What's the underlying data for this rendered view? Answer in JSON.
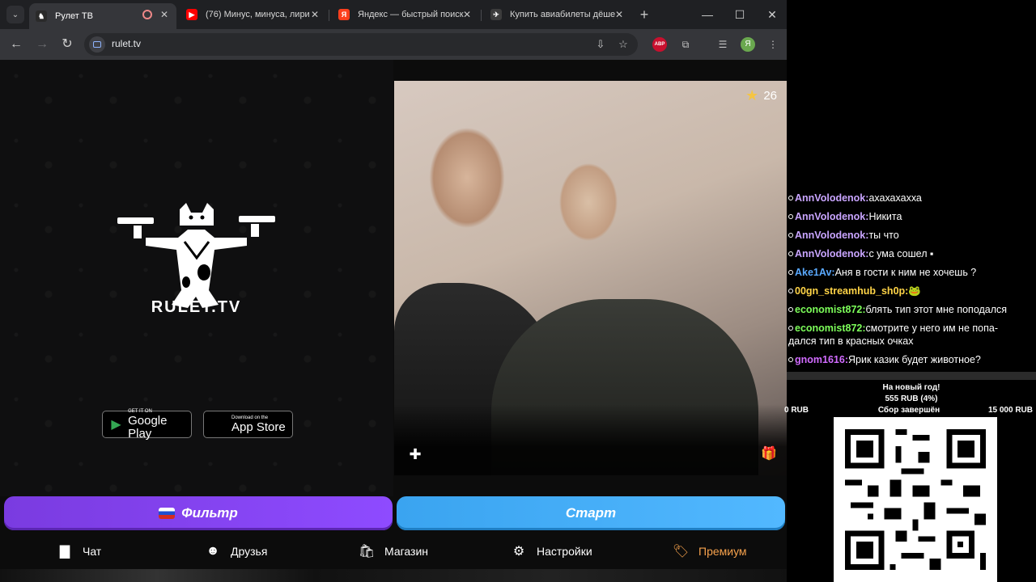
{
  "browser": {
    "tabs": [
      {
        "title": "Рулет ТВ",
        "favicon_color": "#2a2a2a"
      },
      {
        "title": "(76) Минус, минуса, лири",
        "favicon_color": "#ff0000"
      },
      {
        "title": "Яндекс — быстрый поиск",
        "favicon_color": "#fc3f1d"
      },
      {
        "title": "Купить авиабилеты дёше",
        "favicon_color": "#3c3c3c"
      }
    ],
    "url": "rulet.tv",
    "profile_initial": "Я",
    "abp_label": "ABP"
  },
  "page": {
    "logo_text": "RULET.TV",
    "google_play": {
      "small": "GET IT ON",
      "big": "Google Play"
    },
    "app_store": {
      "small": "Download on the",
      "big": "App Store"
    },
    "rating": "26",
    "filter_label": "Фильтр",
    "start_label": "Старт",
    "nav": [
      {
        "label": "Чат",
        "icon": "chat-icon"
      },
      {
        "label": "Друзья",
        "icon": "friends-icon"
      },
      {
        "label": "Магазин",
        "icon": "shop-icon"
      },
      {
        "label": "Настройки",
        "icon": "gear-icon"
      },
      {
        "label": "Премиум",
        "icon": "tag-icon"
      }
    ],
    "colors": {
      "filter": "#7a3be0",
      "start": "#3aa4f0",
      "premium": "#f5a14c"
    }
  },
  "chat": {
    "messages": [
      {
        "user": "AnnVolodenok:",
        "text": "ахахахахха",
        "color": "#c9a5ff"
      },
      {
        "user": "AnnVolodenok:",
        "text": "Никита",
        "color": "#c9a5ff"
      },
      {
        "user": "AnnVolodenok:",
        "text": "ты что",
        "color": "#c9a5ff"
      },
      {
        "user": "AnnVolodenok:",
        "text": "с ума сошел ▪",
        "color": "#c9a5ff"
      },
      {
        "user": "Ake1Av:",
        "text": "Аня в гости к ним не хочешь ?",
        "color": "#5aa9ff"
      },
      {
        "user": "00gn_streamhub_sh0p:",
        "text": "🐸",
        "color": "#ffd447"
      },
      {
        "user": "economist872:",
        "text": "блять тип этот мне поподался",
        "color": "#7dff5a"
      },
      {
        "user": "economist872:",
        "text": "смотрите у него им не попа-",
        "text2": "дался тип в красных очках",
        "color": "#7dff5a"
      },
      {
        "user": "gnom1616:",
        "text": "Ярик казик будет животное?",
        "color": "#d16bff"
      }
    ]
  },
  "donation": {
    "title": "На новый год!",
    "amount": "555 RUB (4%)",
    "min": "0 RUB",
    "status": "Сбор завершён",
    "max": "15 000 RUB"
  }
}
